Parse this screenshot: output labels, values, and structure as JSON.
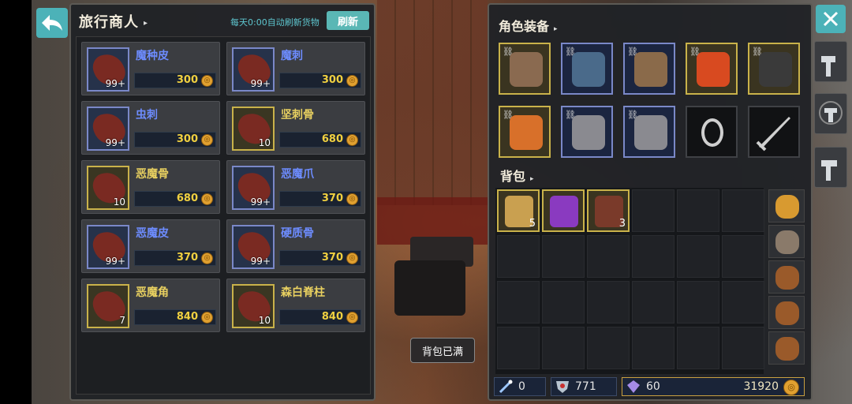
{
  "merchant": {
    "title": "旅行商人",
    "title_arrow": "▸",
    "refresh_note": "每天0:00自动刷新货物",
    "refresh_label": "刷新",
    "items": [
      {
        "name": "魔种皮",
        "qty": "99+",
        "price": "300",
        "rarity": "blue"
      },
      {
        "name": "魔刺",
        "qty": "99+",
        "price": "300",
        "rarity": "blue"
      },
      {
        "name": "虫刺",
        "qty": "99+",
        "price": "300",
        "rarity": "blue"
      },
      {
        "name": "坚刺骨",
        "qty": "10",
        "price": "680",
        "rarity": "gold"
      },
      {
        "name": "恶魔骨",
        "qty": "10",
        "price": "680",
        "rarity": "gold"
      },
      {
        "name": "恶魔爪",
        "qty": "99+",
        "price": "370",
        "rarity": "blue"
      },
      {
        "name": "恶魔皮",
        "qty": "99+",
        "price": "370",
        "rarity": "blue"
      },
      {
        "name": "硬质骨",
        "qty": "99+",
        "price": "370",
        "rarity": "blue"
      },
      {
        "name": "恶魔角",
        "qty": "7",
        "price": "840",
        "rarity": "gold"
      },
      {
        "name": "森白脊柱",
        "qty": "10",
        "price": "840",
        "rarity": "gold"
      }
    ]
  },
  "equipment": {
    "title": "角色装备",
    "title_arrow": "▸",
    "slots": [
      {
        "icon": "helmet-icon",
        "rarity": "gold",
        "color": "#8a6a50"
      },
      {
        "icon": "chest-armor-icon",
        "rarity": "blue",
        "color": "#4a6a8a"
      },
      {
        "icon": "leg-armor-icon",
        "rarity": "blue",
        "color": "#8a6a4a"
      },
      {
        "icon": "ring-icon",
        "rarity": "gold",
        "color": "#d84a20"
      },
      {
        "icon": "sword-icon",
        "rarity": "gold",
        "color": "#3a3a3a"
      },
      {
        "icon": "amulet-icon",
        "rarity": "gold",
        "color": "#d8702a"
      },
      {
        "icon": "gloves-icon",
        "rarity": "blue",
        "color": "#8a8a90"
      },
      {
        "icon": "boots-icon",
        "rarity": "blue",
        "color": "#8a8a90"
      },
      {
        "icon": "empty-ring-slot-icon",
        "rarity": "empty",
        "color": "#222"
      },
      {
        "icon": "empty-weapon-slot-icon",
        "rarity": "empty",
        "color": "#222"
      }
    ]
  },
  "bag": {
    "title": "背包",
    "title_arrow": "▸",
    "items": [
      {
        "icon": "scroll-icon",
        "qty": "5",
        "color": "#c9a050"
      },
      {
        "icon": "potion-icon",
        "qty": "",
        "color": "#8a3ac0"
      },
      {
        "icon": "claw-material-icon",
        "qty": "3",
        "color": "#7a3a2a"
      }
    ],
    "tabs": [
      {
        "icon": "chest-icon",
        "color": "#d89a30"
      },
      {
        "icon": "backpack-icon",
        "color": "#8a7a6a"
      },
      {
        "icon": "pouch-icon",
        "color": "#9a5a2a"
      },
      {
        "icon": "pouch-icon",
        "color": "#9a5a2a"
      },
      {
        "icon": "pouch-icon",
        "color": "#9a5a2a"
      }
    ]
  },
  "currency": {
    "magic": "0",
    "honor": "771",
    "gem": "60",
    "gold": "31920"
  },
  "toast": "背包已满",
  "colors": {
    "accent": "#4cb2b8",
    "blue_frame": "#7a88c8",
    "gold_frame": "#c9b24a",
    "price_text": "#f0d040"
  }
}
